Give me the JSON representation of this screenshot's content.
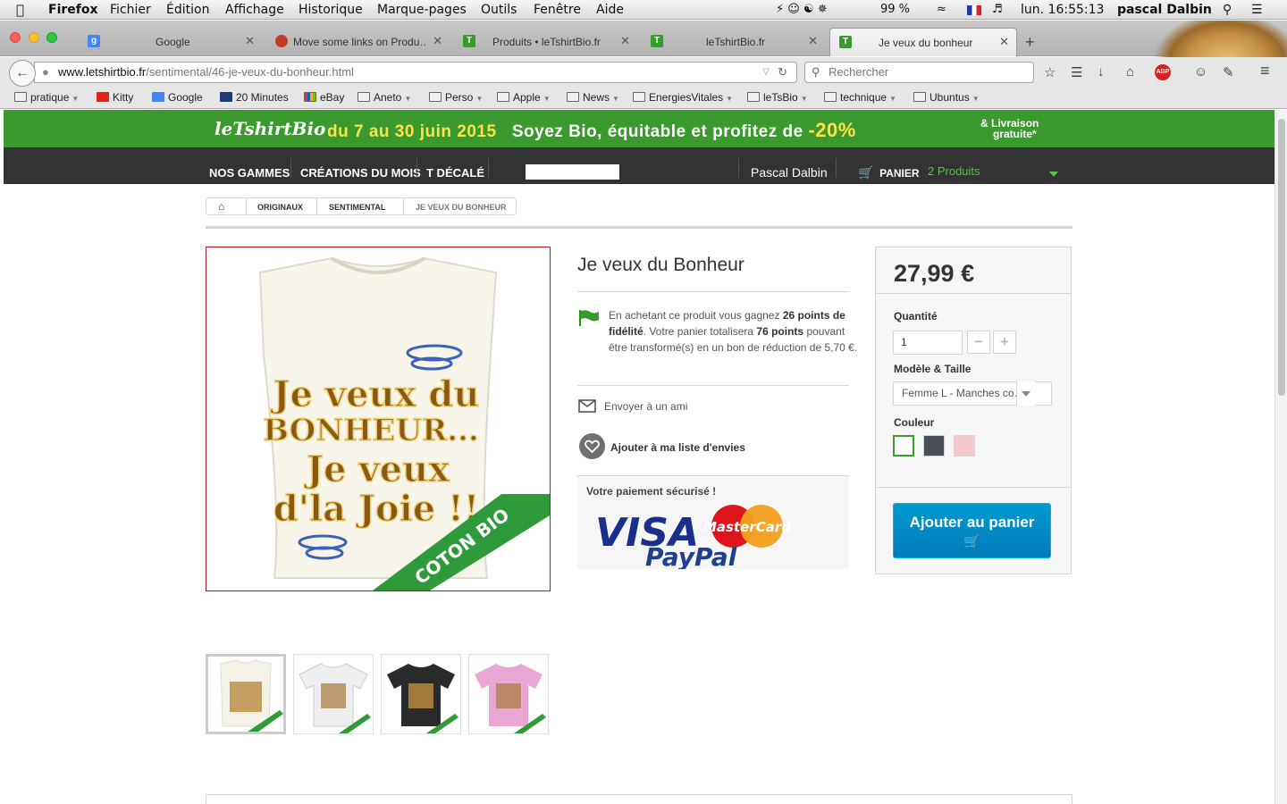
{
  "os_menubar": {
    "app": "Firefox",
    "menus": [
      "Fichier",
      "Édition",
      "Affichage",
      "Historique",
      "Marque-pages",
      "Outils",
      "Fenêtre",
      "Aide"
    ],
    "battery": "99 %",
    "clock": "lun. 16:55:13",
    "user": "pascal Dalbin"
  },
  "tabs": [
    {
      "title": "Google"
    },
    {
      "title": "Move some links on Produ…"
    },
    {
      "title": "Produits • leTshirtBio.fr"
    },
    {
      "title": "leTshirtBio.fr"
    },
    {
      "title": "Je veux du bonheur"
    }
  ],
  "navbar": {
    "url_domain": "www.letshirtbio.fr",
    "url_path": "/sentimental/46-je-veux-du-bonheur.html",
    "search_placeholder": "Rechercher"
  },
  "bookmarks": [
    {
      "label": "pratique",
      "folder": true
    },
    {
      "label": "Kitty",
      "folder": false
    },
    {
      "label": "Google",
      "folder": false
    },
    {
      "label": "20 Minutes",
      "folder": false
    },
    {
      "label": "eBay",
      "folder": false
    },
    {
      "label": "Aneto",
      "folder": true
    },
    {
      "label": "Perso",
      "folder": true
    },
    {
      "label": "Apple",
      "folder": true
    },
    {
      "label": "News",
      "folder": true
    },
    {
      "label": "EnergiesVitales",
      "folder": true
    },
    {
      "label": "leTsBio",
      "folder": true
    },
    {
      "label": "technique",
      "folder": true
    },
    {
      "label": "Ubuntus",
      "folder": true
    }
  ],
  "banner": {
    "logo": "leTshirtBio",
    "dates": "du 7 au 30 juin 2015",
    "slogan": "Soyez Bio, équitable et profitez de",
    "discount": "-20%",
    "shipping_line1": "& Livraison",
    "shipping_line2": "gratuite*"
  },
  "topnav": {
    "items": [
      "NOS GAMMES",
      "CRÉATIONS DU MOIS",
      "T DÉCALÉ"
    ],
    "user": "Pascal Dalbin",
    "cart_label": "PANIER",
    "cart_count": "2 Produits"
  },
  "breadcrumb": [
    "ORIGINAUX",
    "SENTIMENTAL",
    "JE VEUX DU BONHEUR"
  ],
  "product": {
    "title": "Je veux du Bonheur",
    "loyalty_pre": "En achetant ce produit vous gagnez",
    "loyalty_points": "26 points de fidélité",
    "loyalty_mid": ". Votre panier totalisera",
    "loyalty_total": "76 points",
    "loyalty_post": "pouvant être transformé(s) en un bon de réduction de 5,70 €.",
    "send_friend": "Envoyer à un ami",
    "wishlist": "Ajouter à ma liste d'envies",
    "payment_title": "Votre paiement sécurisé !",
    "payment_logos": [
      "VISA",
      "MasterCard",
      "PayPal"
    ],
    "image_text_line1": "Je veux du",
    "image_text_line2": "BONHEUR...",
    "image_text_line3": "Je veux",
    "image_text_line4": "d'la Joie !!",
    "ribbon": "COTON BIO"
  },
  "buybox": {
    "price": "27,99 €",
    "quantity_label": "Quantité",
    "quantity_value": "1",
    "minus": "−",
    "plus": "+",
    "model_label": "Modèle & Taille",
    "model_value": "Femme L - Manches co…",
    "color_label": "Couleur",
    "colors": [
      "#ffffff",
      "#4a4f57",
      "#f5c8cc"
    ],
    "add_to_cart": "Ajouter au panier"
  },
  "thumbnails": [
    {
      "color": "#f4f1e6"
    },
    {
      "color": "#eeeeee"
    },
    {
      "color": "#2a2a2a"
    },
    {
      "color": "#e9a6d2"
    }
  ],
  "colors": {
    "brand_green": "#3a9a2d",
    "nav_dark": "#333333",
    "cart_green": "#52c741",
    "button_blue": "#0088c4"
  }
}
